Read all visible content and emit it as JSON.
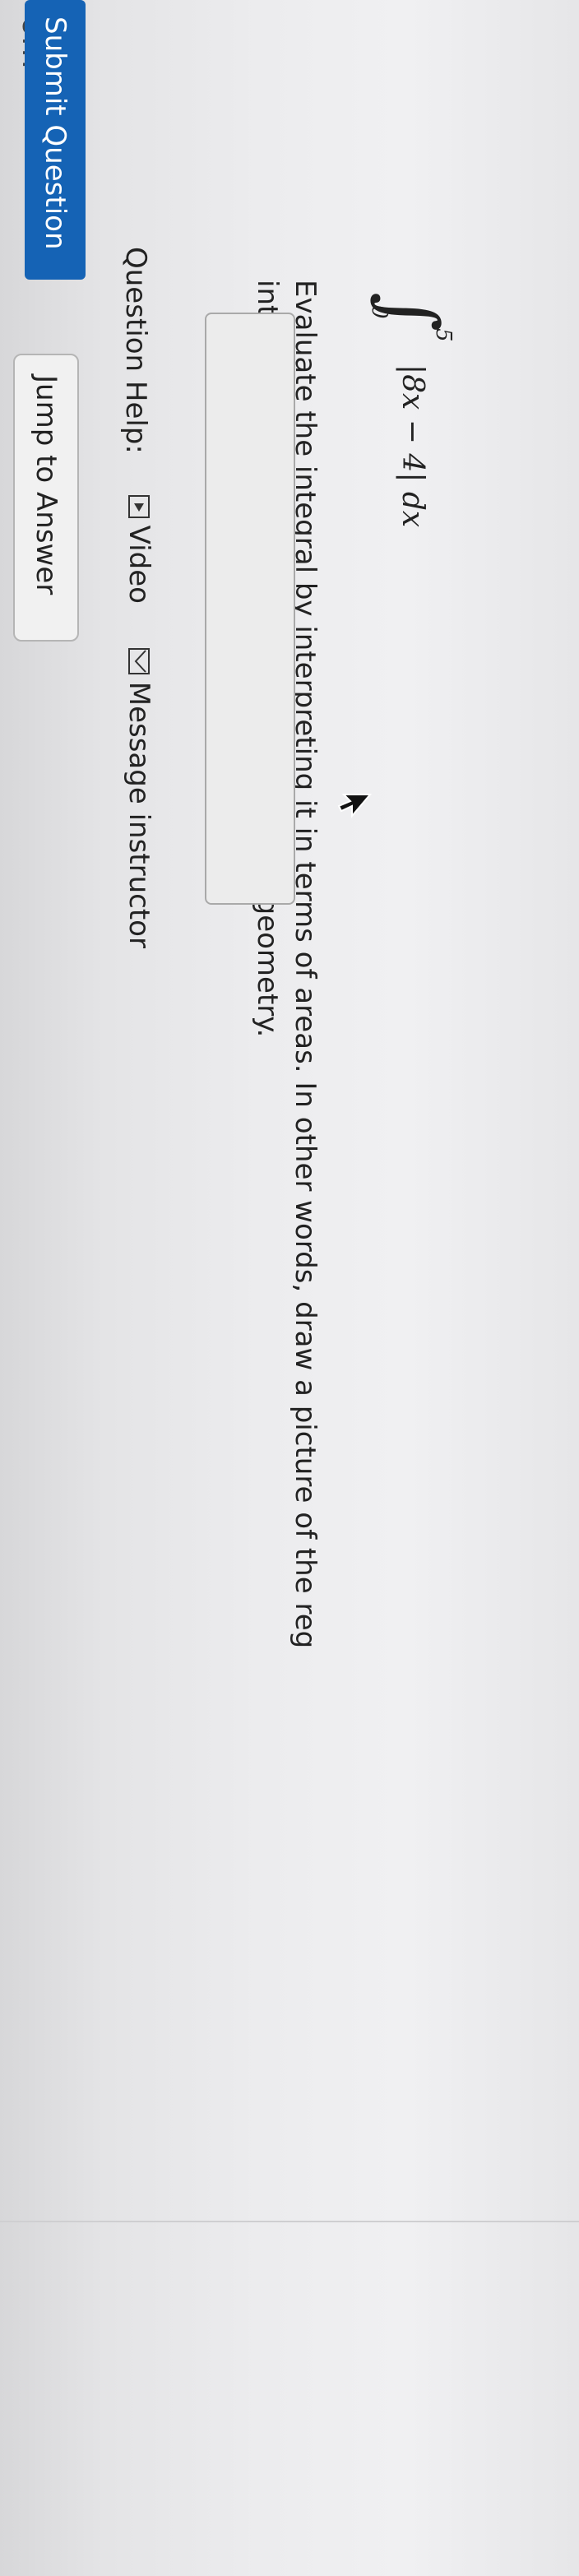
{
  "site_fragment": "om",
  "question": {
    "line1": "Evaluate the integral by interpreting it in terms of areas. In other words, draw a picture of the reg",
    "line2": "integral represents, and find the area using geometry.",
    "integral": {
      "symbol": "∫",
      "upper": "5",
      "lower": "0",
      "integrand": "|8x − 4| dx"
    },
    "answer_value": ""
  },
  "help": {
    "label": "Question Help:",
    "video_label": "Video",
    "message_label": "Message instructor",
    "icons": [
      "video-icon",
      "envelope-icon"
    ]
  },
  "buttons": {
    "submit_label": "Submit Question",
    "jump_label": "Jump to Answer"
  },
  "colors": {
    "submit_bg": "#1563b5",
    "submit_text": "#ffffff",
    "text": "#222222"
  }
}
